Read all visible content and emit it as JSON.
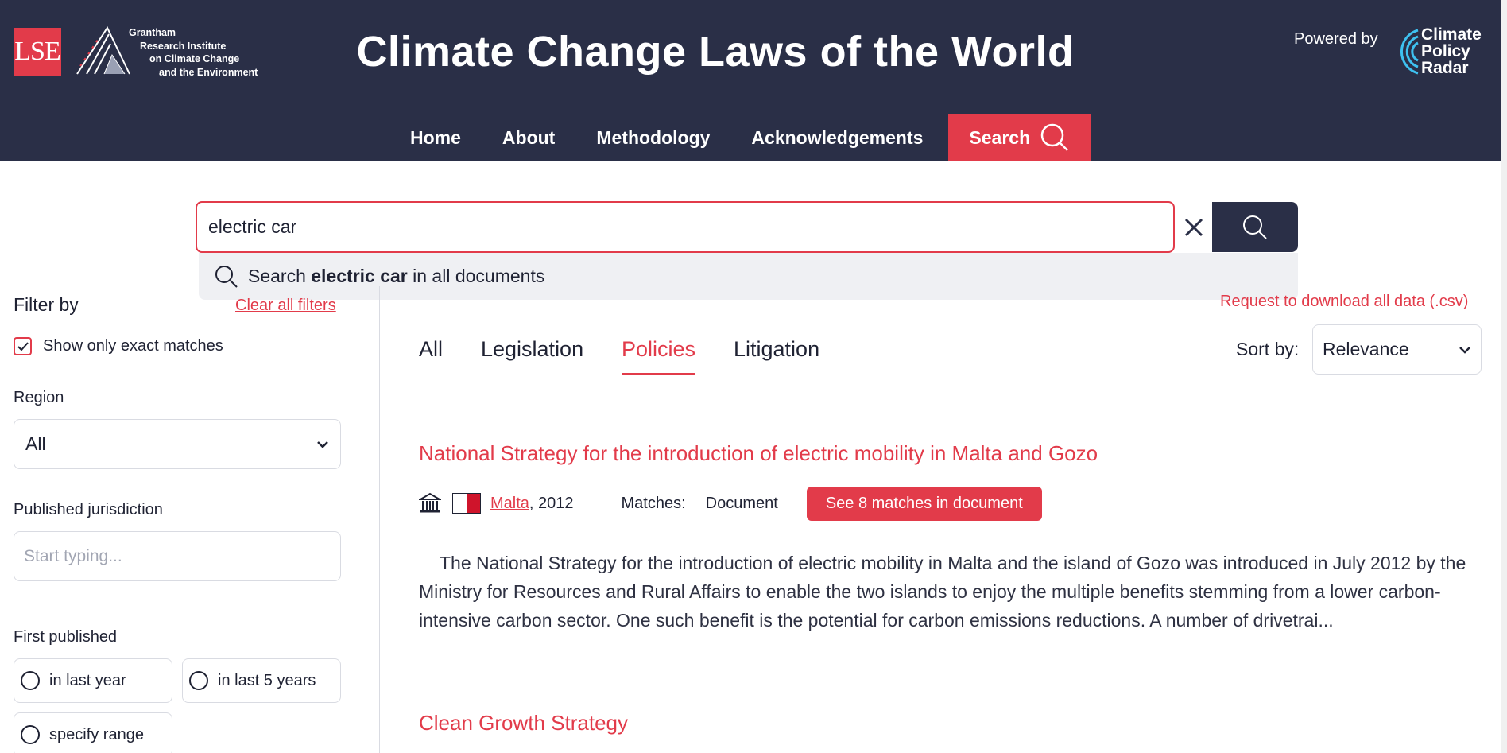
{
  "header": {
    "lse_logo": "LSE",
    "grantham_lines": [
      "Grantham",
      "Research Institute",
      "on Climate Change",
      "and the Environment"
    ],
    "site_title": "Climate Change Laws of the World",
    "powered_by": "Powered by",
    "partner_lines": [
      "Climate",
      "Policy",
      "Radar"
    ]
  },
  "nav": {
    "items": [
      {
        "label": "Home"
      },
      {
        "label": "About"
      },
      {
        "label": "Methodology"
      },
      {
        "label": "Acknowledgements"
      },
      {
        "label": "Search",
        "active": true
      }
    ]
  },
  "search": {
    "query": "electric car",
    "suggestion_prefix": "Search",
    "suggestion_term": "electric car",
    "suggestion_suffix": "in all documents"
  },
  "sidebar": {
    "filter_title": "Filter by",
    "clear_filters": "Clear all filters",
    "exact_match_label": "Show only exact matches",
    "exact_match_checked": true,
    "region_label": "Region",
    "region_value": "All",
    "jurisdiction_label": "Published jurisdiction",
    "jurisdiction_placeholder": "Start typing...",
    "first_published_label": "First published",
    "first_published_options": [
      "in last year",
      "in last 5 years",
      "specify range"
    ]
  },
  "main": {
    "download_link": "Request to download all data (.csv)",
    "tabs": [
      {
        "label": "All"
      },
      {
        "label": "Legislation"
      },
      {
        "label": "Policies",
        "active": true
      },
      {
        "label": "Litigation"
      }
    ],
    "sort_label": "Sort by:",
    "sort_value": "Relevance",
    "results": [
      {
        "title": "National Strategy for the introduction of electric mobility in Malta and Gozo",
        "country": "Malta",
        "year": ", 2012",
        "matches_label": "Matches:",
        "matches_type": "Document",
        "matches_button": "See 8 matches in document",
        "snippet": "The National Strategy for the introduction of electric mobility in Malta and the island of Gozo was introduced in July 2012 by the Ministry for Resources and Rural Affairs to enable the two islands to enjoy the multiple benefits stemming from a lower carbon-intensive carbon sector. One such benefit is the potential for carbon emissions reductions. A number of drivetrai..."
      },
      {
        "title": "Clean Growth Strategy"
      }
    ]
  },
  "colors": {
    "header_bg": "#2a2f47",
    "accent": "#e23b4a",
    "text": "#1f2233"
  }
}
